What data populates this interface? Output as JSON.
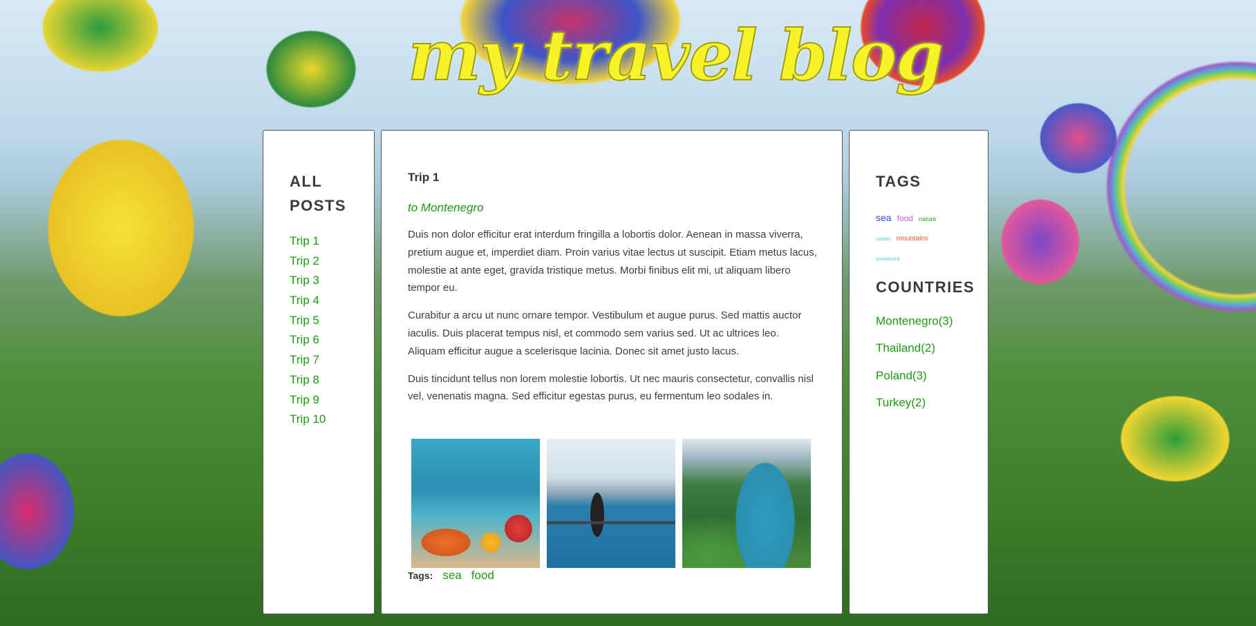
{
  "header": {
    "blog_title": "my travel blog"
  },
  "sidebar_left": {
    "heading": "ALL POSTS",
    "posts": [
      {
        "label": "Trip 1"
      },
      {
        "label": "Trip 2"
      },
      {
        "label": "Trip 3"
      },
      {
        "label": "Trip 4"
      },
      {
        "label": "Trip 5"
      },
      {
        "label": "Trip 6"
      },
      {
        "label": "Trip 7"
      },
      {
        "label": "Trip 8"
      },
      {
        "label": "Trip 9"
      },
      {
        "label": "Trip 10"
      }
    ]
  },
  "post": {
    "title": "Trip 1",
    "subtitle": "to Montenegro",
    "paragraphs": [
      "Duis non dolor efficitur erat interdum fringilla a lobortis dolor. Aenean in massa viverra, pretium augue et, imperdiet diam. Proin varius vitae lectus ut suscipit. Etiam metus lacus, molestie at ante eget, gravida tristique metus. Morbi finibus elit mi, ut aliquam libero tempor eu.",
      "Curabitur a arcu ut nunc ornare tempor. Vestibulum et augue purus. Sed mattis auctor iaculis. Duis placerat tempus nisl, et commodo sem varius sed. Ut ac ultrices leo. Aliquam efficitur augue a scelerisque lacinia. Donec sit amet justo lacus.",
      "Duis tincidunt tellus non lorem molestie lobortis. Ut nec mauris consectetur, convallis nisl vel, venenatis magna. Sed efficitur egestas purus, eu fermentum leo sodales in."
    ],
    "tags_label": "Tags:",
    "tags": [
      "sea",
      "food"
    ]
  },
  "sidebar_right": {
    "tags_heading": "TAGS",
    "tag_cloud": {
      "sea": "sea",
      "food": "food",
      "nature": "nature",
      "castles": "castles",
      "mountains": "mountains",
      "snowboard": "snowboard"
    },
    "countries_heading": "COUNTRIES",
    "countries": [
      {
        "label": "Montenegro(3)"
      },
      {
        "label": "Thailand(2)"
      },
      {
        "label": "Poland(3)"
      },
      {
        "label": "Turkey(2)"
      }
    ]
  },
  "colors": {
    "link_green": "#1d9a12",
    "title_yellow": "#f7f32a"
  }
}
